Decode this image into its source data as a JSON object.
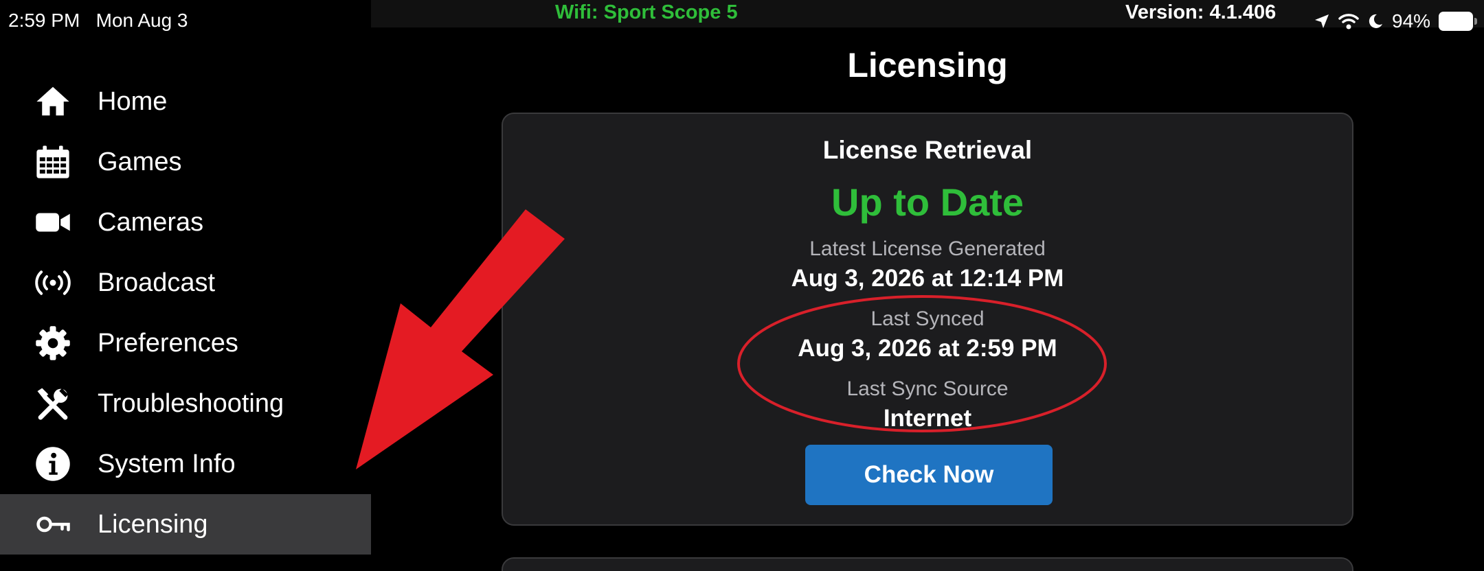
{
  "status_bar": {
    "time": "2:59 PM",
    "date": "Mon Aug 3",
    "wifi": "Wifi: Sport Scope 5",
    "version": "Version: 4.1.406",
    "battery": "94%",
    "icons": [
      "location-arrow-icon",
      "wifi-icon",
      "moon-icon",
      "battery-icon"
    ]
  },
  "sidebar": {
    "items": [
      {
        "label": "Home",
        "icon": "home-icon"
      },
      {
        "label": "Games",
        "icon": "calendar-icon"
      },
      {
        "label": "Cameras",
        "icon": "video-camera-icon"
      },
      {
        "label": "Broadcast",
        "icon": "broadcast-icon"
      },
      {
        "label": "Preferences",
        "icon": "gear-icon"
      },
      {
        "label": "Troubleshooting",
        "icon": "tools-icon"
      },
      {
        "label": "System Info",
        "icon": "info-icon"
      },
      {
        "label": "Licensing",
        "icon": "key-icon"
      }
    ],
    "active": "Licensing"
  },
  "main": {
    "title": "Licensing",
    "card": {
      "title": "License Retrieval",
      "status": "Up to Date",
      "latest_label": "Latest License Generated",
      "latest_value": "Aug 3, 2026 at 12:14 PM",
      "synced_label": "Last Synced",
      "synced_value": "Aug 3, 2026 at 2:59 PM",
      "source_label": "Last Sync Source",
      "source_value": "Internet",
      "button": "Check Now"
    }
  },
  "colors": {
    "accent_green": "#2fbe3a",
    "button_blue": "#1f74c2",
    "annotation_red": "#e41b23"
  }
}
